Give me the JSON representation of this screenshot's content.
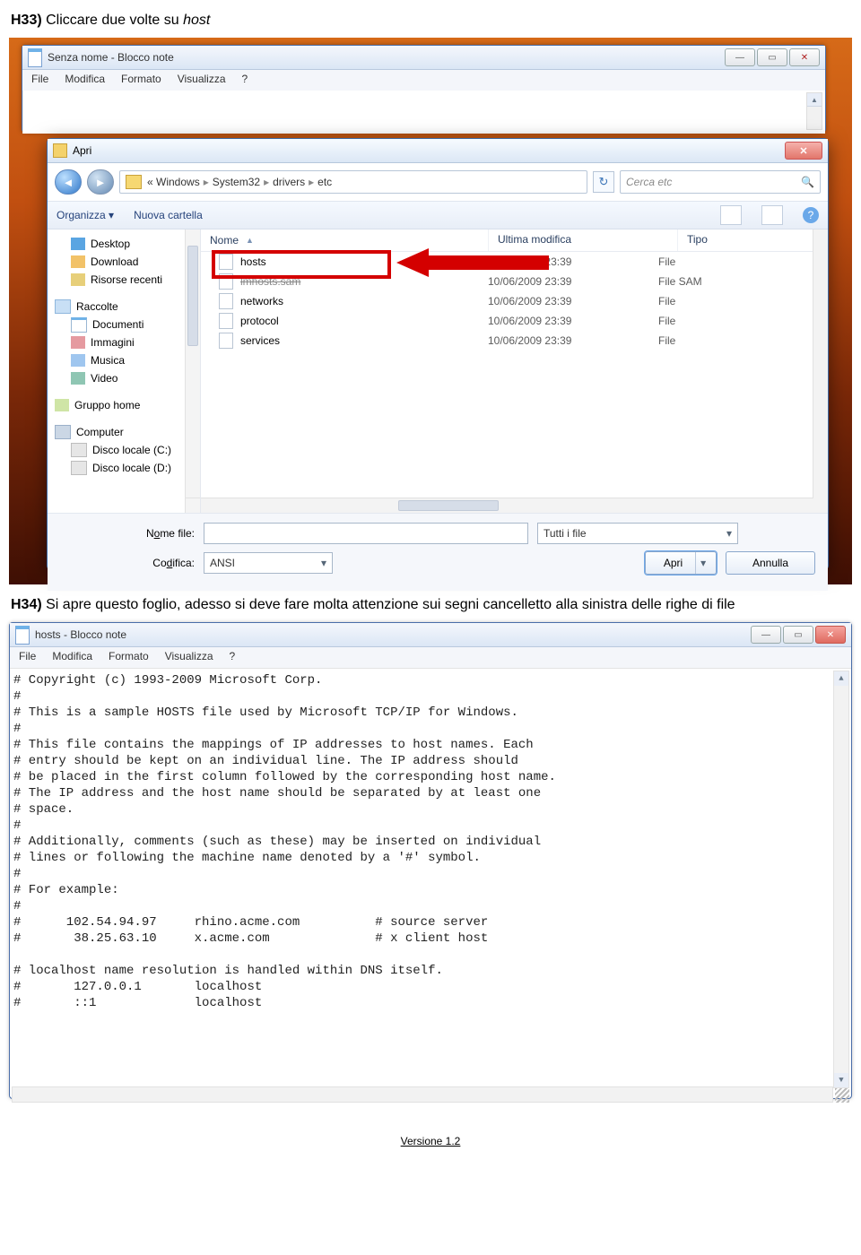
{
  "doc": {
    "h33_prefix": "H33) ",
    "h33_text": "Cliccare due volte su ",
    "h33_em": "host",
    "h34_prefix": "H34) ",
    "h34_text": "Si apre questo foglio, adesso si deve fare molta attenzione sui segni cancelletto alla sinistra delle righe di file",
    "footer": "Versione 1.2"
  },
  "notepad": {
    "title": "Senza nome - Blocco note",
    "menus": [
      "File",
      "Modifica",
      "Formato",
      "Visualizza",
      "?"
    ]
  },
  "openDialog": {
    "title": "Apri",
    "back": "◄",
    "fwd": "►",
    "path": [
      "«  Windows",
      "System32",
      "drivers",
      "etc"
    ],
    "refresh": "↻",
    "searchPlaceholder": "Cerca etc",
    "searchIcon": "🔍",
    "toolbar": {
      "organize": "Organizza ▾",
      "newFolder": "Nuova cartella"
    },
    "tree": {
      "favs": [
        "Desktop",
        "Download",
        "Risorse recenti"
      ],
      "libsLabel": "Raccolte",
      "libs": [
        "Documenti",
        "Immagini",
        "Musica",
        "Video"
      ],
      "homegroup": "Gruppo home",
      "computer": "Computer",
      "drives": [
        "Disco locale (C:)",
        "Disco locale (D:)"
      ]
    },
    "columns": {
      "name": "Nome",
      "date": "Ultima modifica",
      "type": "Tipo"
    },
    "files": [
      {
        "name": "hosts",
        "date": "10/06/2009 23:39",
        "type": "File",
        "hl": true
      },
      {
        "name": "lmhosts.sam",
        "date": "10/06/2009 23:39",
        "type": "File SAM",
        "strike": true
      },
      {
        "name": "networks",
        "date": "10/06/2009 23:39",
        "type": "File"
      },
      {
        "name": "protocol",
        "date": "10/06/2009 23:39",
        "type": "File"
      },
      {
        "name": "services",
        "date": "10/06/2009 23:39",
        "type": "File"
      }
    ],
    "bottom": {
      "fileLabelPre": "N",
      "fileLabelUnd": "o",
      "fileLabelPost": "me file:",
      "encLabelPre": "Co",
      "encLabelUnd": "d",
      "encLabelPost": "ifica:",
      "filter": "Tutti i file",
      "encoding": "ANSI",
      "open": "Apri",
      "cancel": "Annulla"
    }
  },
  "hosts": {
    "title": "hosts - Blocco note",
    "menus": [
      "File",
      "Modifica",
      "Formato",
      "Visualizza",
      "?"
    ],
    "content": "# Copyright (c) 1993-2009 Microsoft Corp.\n#\n# This is a sample HOSTS file used by Microsoft TCP/IP for Windows.\n#\n# This file contains the mappings of IP addresses to host names. Each\n# entry should be kept on an individual line. The IP address should\n# be placed in the first column followed by the corresponding host name.\n# The IP address and the host name should be separated by at least one\n# space.\n#\n# Additionally, comments (such as these) may be inserted on individual\n# lines or following the machine name denoted by a '#' symbol.\n#\n# For example:\n#\n#      102.54.94.97     rhino.acme.com          # source server\n#       38.25.63.10     x.acme.com              # x client host\n\n# localhost name resolution is handled within DNS itself.\n#\t127.0.0.1       localhost\n#\t::1             localhost"
  }
}
